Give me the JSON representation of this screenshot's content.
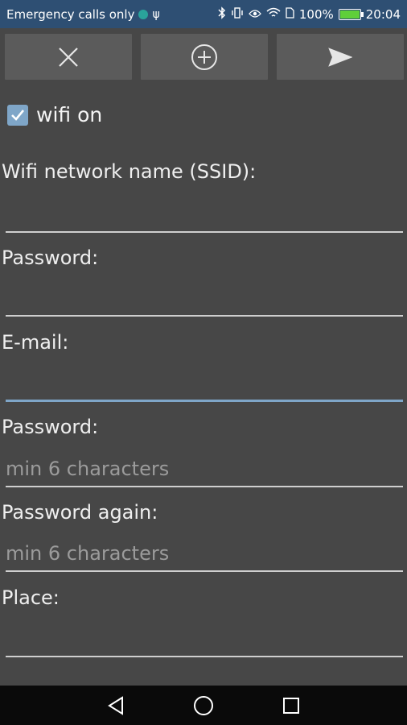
{
  "status_bar": {
    "carrier_text": "Emergency calls only",
    "usb_icon": "usb-icon",
    "battery_percent": "100%",
    "battery_level": 1.0,
    "time": "20:04"
  },
  "toolbar": {
    "buttons": [
      {
        "icon": "close-icon"
      },
      {
        "icon": "add-circle-icon"
      },
      {
        "icon": "send-icon"
      }
    ]
  },
  "wifi_toggle": {
    "label": "wifi on",
    "checked": true
  },
  "form": {
    "ssid_label": "Wifi network name (SSID):",
    "ssid_value": "",
    "wifi_password_label": "Password:",
    "wifi_password_value": "",
    "email_label": "E-mail:",
    "email_value": "",
    "password_label": "Password:",
    "password_placeholder": "min 6 characters",
    "password_again_label": "Password again:",
    "password_again_placeholder": "min 6 characters",
    "place_label": "Place:",
    "place_value": ""
  },
  "colors": {
    "background": "#474747",
    "status_bar": "#2e4f73",
    "accent": "#7fa6c8",
    "button": "#5b5b5b"
  }
}
